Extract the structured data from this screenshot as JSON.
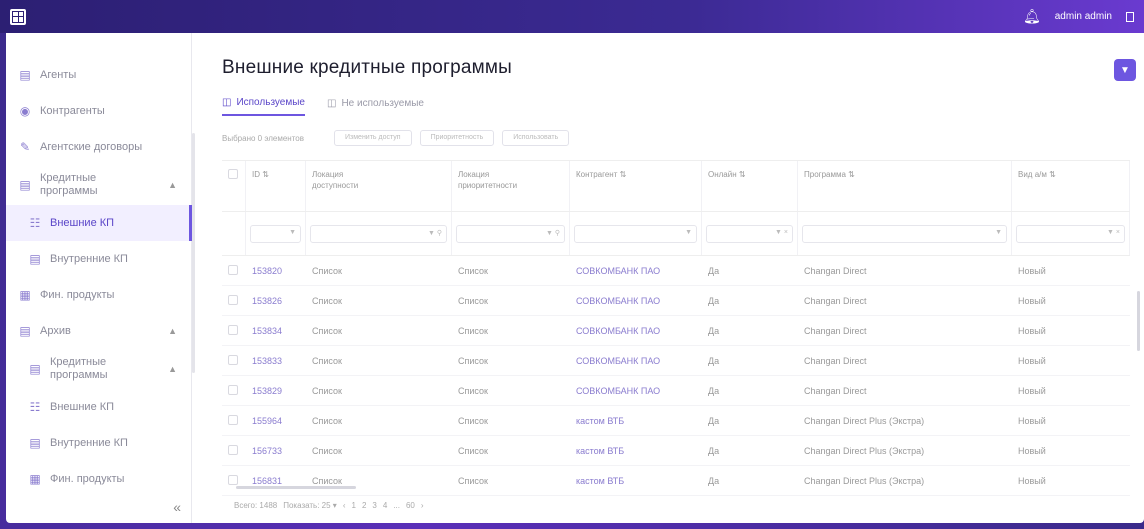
{
  "topbar": {
    "user": "admin admin"
  },
  "sidebar": {
    "items": [
      {
        "label": "Агенты",
        "icon": "doc-icon"
      },
      {
        "label": "Контрагенты",
        "icon": "people-icon"
      },
      {
        "label": "Агентские договоры",
        "icon": "pen-icon"
      },
      {
        "label": "Кредитные программы",
        "icon": "card-icon"
      },
      {
        "label": "Внешние КП",
        "icon": "bank-icon"
      },
      {
        "label": "Внутренние КП",
        "icon": "card-icon"
      },
      {
        "label": "Фин. продукты",
        "icon": "grid-icon"
      },
      {
        "label": "Архив",
        "icon": "archive-icon"
      },
      {
        "label": "Кредитные программы",
        "icon": "card-icon"
      },
      {
        "label": "Внешние КП",
        "icon": "bank-icon"
      },
      {
        "label": "Внутренние КП",
        "icon": "card-icon"
      },
      {
        "label": "Фин. продукты",
        "icon": "grid-icon"
      }
    ]
  },
  "main": {
    "title": "Внешние кредитные программы",
    "tabs": [
      "Используемые",
      "Не используемые"
    ],
    "toolbar": {
      "selected": "Выбрано 0 элементов",
      "buttons": [
        "Изменить доступ",
        "Приоритетность",
        "Использовать"
      ]
    }
  },
  "table": {
    "headers": [
      "ID",
      "Локация доступности",
      "Локация приоритетности",
      "Контрагент",
      "Онлайн",
      "Программа",
      "Вид а/м"
    ],
    "rows": [
      {
        "id": "153820",
        "pa": "Список",
        "pp": "Список",
        "ka": "СОВКОМБАНК ПАО",
        "on": "Да",
        "pr": "Changan Direct",
        "va": "Новый"
      },
      {
        "id": "153826",
        "pa": "Список",
        "pp": "Список",
        "ka": "СОВКОМБАНК ПАО",
        "on": "Да",
        "pr": "Changan Direct",
        "va": "Новый"
      },
      {
        "id": "153834",
        "pa": "Список",
        "pp": "Список",
        "ka": "СОВКОМБАНК ПАО",
        "on": "Да",
        "pr": "Changan Direct",
        "va": "Новый"
      },
      {
        "id": "153833",
        "pa": "Список",
        "pp": "Список",
        "ka": "СОВКОМБАНК ПАО",
        "on": "Да",
        "pr": "Changan Direct",
        "va": "Новый"
      },
      {
        "id": "153829",
        "pa": "Список",
        "pp": "Список",
        "ka": "СОВКОМБАНК ПАО",
        "on": "Да",
        "pr": "Changan Direct",
        "va": "Новый"
      },
      {
        "id": "155964",
        "pa": "Список",
        "pp": "Список",
        "ka": "кастом ВТБ",
        "on": "Да",
        "pr": "Changan Direct Plus (Экстра)",
        "va": "Новый"
      },
      {
        "id": "156733",
        "pa": "Список",
        "pp": "Список",
        "ka": "кастом ВТБ",
        "on": "Да",
        "pr": "Changan Direct Plus (Экстра)",
        "va": "Новый"
      },
      {
        "id": "156831",
        "pa": "Список",
        "pp": "Список",
        "ka": "кастом ВТБ",
        "on": "Да",
        "pr": "Changan Direct Plus (Экстра)",
        "va": "Новый"
      }
    ],
    "footer": {
      "total": "Всего: 1488",
      "show": "Показать: 25",
      "pages": [
        "1",
        "2",
        "3",
        "4",
        "...",
        "60"
      ]
    }
  }
}
